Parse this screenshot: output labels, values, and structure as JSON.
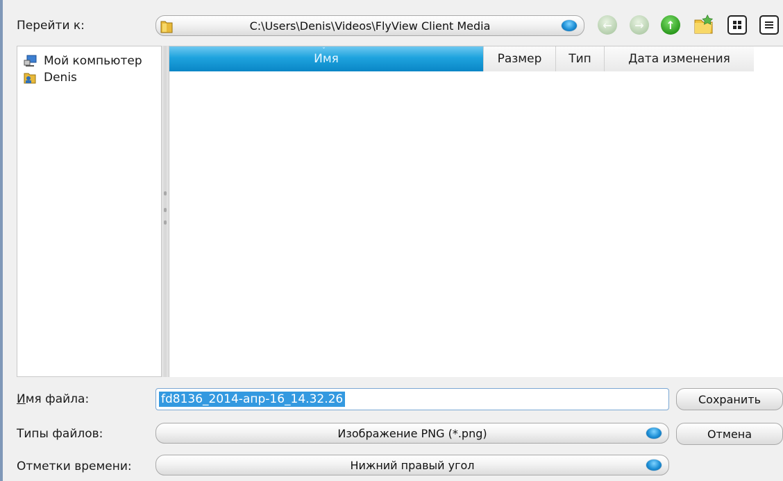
{
  "window": {
    "accent_color": "#1ea3de"
  },
  "top_bar": {
    "goto_label": "Перейти к:",
    "path": "C:\\Users\\Denis\\Videos\\FlyView Client Media",
    "nav_buttons": [
      "back-icon",
      "forward-icon",
      "up-folder-icon",
      "new-folder-icon",
      "icon-view-icon",
      "list-view-icon"
    ]
  },
  "sidebar": {
    "items": [
      {
        "label": "Мой компьютер",
        "icon": "computer-icon"
      },
      {
        "label": "Denis",
        "icon": "user-folder-icon"
      }
    ]
  },
  "file_list": {
    "columns": [
      "Имя",
      "Размер",
      "Тип",
      "Дата изменения"
    ],
    "sorted_column": "Имя",
    "rows": []
  },
  "form": {
    "filename_label": "Имя файла:",
    "filename_value": "fd8136_2014-апр-16_14.32.26",
    "filetype_label": "Типы файлов:",
    "filetype_value": "Изображение PNG (*.png)",
    "timestamp_label": "Отметки времени:",
    "timestamp_value": "Нижний правый угол",
    "save_label": "Сохранить",
    "cancel_label": "Отмена"
  }
}
